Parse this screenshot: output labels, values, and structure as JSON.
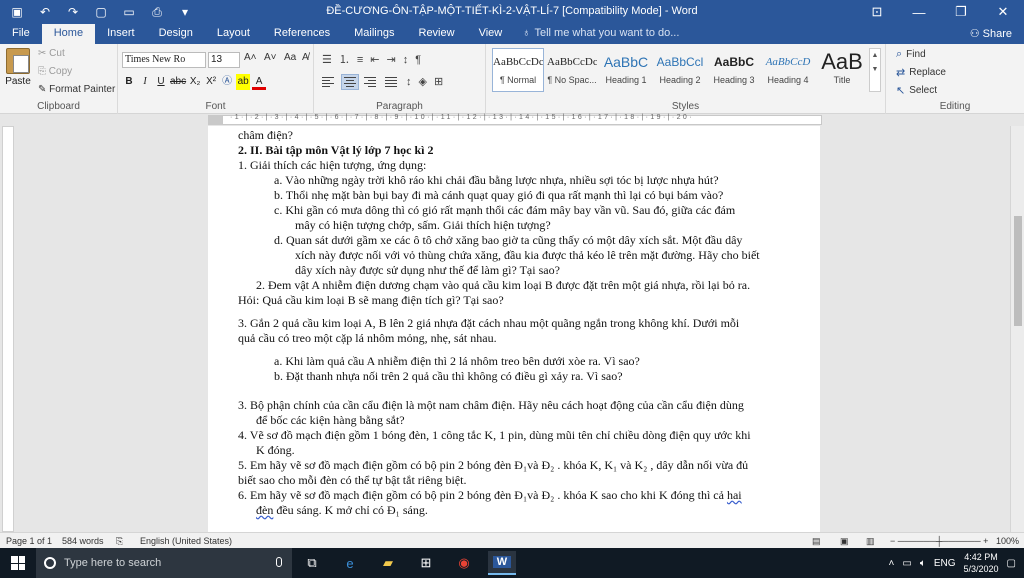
{
  "window": {
    "title": "ĐỀ-CƯƠNG-ÔN-TẬP-MỘT-TIẾT-KÌ-2-VẬT-LÍ-7 [Compatibility Mode] - Word",
    "controls": {
      "minimize": "—",
      "restore": "❐",
      "close": "✕"
    }
  },
  "ribbon_tabs": [
    "File",
    "Home",
    "Insert",
    "Design",
    "Layout",
    "References",
    "Mailings",
    "Review",
    "View"
  ],
  "tell_me": "Tell me what you want to do...",
  "share": "Share",
  "clipboard": {
    "paste": "Paste",
    "cut": "Cut",
    "copy": "Copy",
    "format_painter": "Format Painter",
    "label": "Clipboard"
  },
  "font": {
    "name": "Times New Ro",
    "size": "13",
    "label": "Font",
    "buttons": [
      "B",
      "I",
      "U",
      "abc",
      "X₂",
      "X²"
    ],
    "grow": "A˄",
    "shrink": "A˅",
    "case": "Aa"
  },
  "paragraph": {
    "label": "Paragraph",
    "show_marks": "¶",
    "sort": "↕"
  },
  "styles": {
    "label": "Styles",
    "items": [
      {
        "sample": "AaBbCcDc",
        "name": "¶ Normal"
      },
      {
        "sample": "AaBbCcDc",
        "name": "¶ No Spac..."
      },
      {
        "sample": "AaBbC",
        "name": "Heading 1"
      },
      {
        "sample": "AaBbCcl",
        "name": "Heading 2"
      },
      {
        "sample": "AaBbC",
        "name": "Heading 3"
      },
      {
        "sample": "AaBbCcD",
        "name": "Heading 4"
      },
      {
        "sample": "AaB",
        "name": "Title"
      }
    ]
  },
  "editing": {
    "find": "Find",
    "replace": "Replace",
    "select": "Select",
    "label": "Editing"
  },
  "ruler_marks": "·1·|·2·|·3·|·4·|·5·|·6·|·7·|·8·|·9·|·10·|·11·|·12·|·13·|·14·|·15·|·16·|·17·|·18·|·19·|·20·",
  "document": {
    "line0": "châm điện?",
    "section": "2.   II. Bài tập môn Vật lý lớp 7 học kì 2",
    "q1": "1.   Giải thích các hiện tượng, ứng dụng:",
    "q1a": "a.   Vào những ngày trời khô ráo khi chải đầu bằng lược nhựa, nhiều sợi tóc bị lược nhựa hút?",
    "q1b": "b.   Thổi nhẹ mặt bàn bụi bay đi mà cánh quạt quay gió đi qua rất mạnh thì lại có bụi bám vào?",
    "q1c_1": "c.   Khi gần có mưa dông thì có gió rất mạnh thổi các đám mây bay vần vũ. Sau đó, giữa các đám",
    "q1c_2": "mây có hiện tượng chớp, sấm. Giải thích hiện tượng?",
    "q1d_1": "d.   Quan sát dưới gầm xe các ô tô chở xăng bao giờ ta cũng thấy có một dây xích sắt. Một đầu dây",
    "q1d_2": "xích này được nối với vỏ thùng chứa xăng, đầu kia được thả kéo lê trên mặt đường. Hãy cho biết",
    "q1d_3": "dây xích này được sử dụng như thế để làm gì? Tại sao?",
    "q2_1": "2.   Đem vật A nhiễm điện dương chạm vào quả cầu kim loại B được đặt trên một giá nhựa, rồi lại bỏ ra.",
    "q2_2": "Hỏi: Quả cầu kim loại B sẽ mang điện tích gì? Tại sao?",
    "q3_1": "3. Gắn 2 quả cầu kim loại A, B lên 2 giá nhựa đặt cách nhau một quãng ngắn trong không khí. Dưới mỗi",
    "q3_2": "quả cầu có treo một cặp lá nhôm mỏng, nhẹ, sát nhau.",
    "q3a": "a.   Khi làm quả cầu A nhiễm điện thì 2 lá nhôm treo bên dưới xòe ra. Vì sao?",
    "q3b": "b.   Đặt thanh nhựa nối trên 2 quả cầu thì không có điều gì xảy ra. Vì sao?",
    "q3n_1": "3.   Bộ phận chính của cần cẩu điện là một nam châm điện. Hãy nêu cách hoạt động của cần cẩu điện dùng",
    "q3n_2": "để bốc các kiện hàng bằng sắt?",
    "q4_1": "4.   Vẽ sơ đồ mạch điện gồm 1 bóng đèn, 1 công tắc K, 1 pin, dùng mũi tên chỉ chiều dòng điện quy ước khi",
    "q4_2": "K đóng.",
    "q5_1": "5.    Em hãy vẽ sơ đồ mạch điện gồm có bộ pin 2 bóng đèn Đ₁và Đ₂ . khóa K, K₁ và K₂ , dây dẫn nối vừa đủ",
    "q5_2": "biết sao cho mỗi đèn có thể tự bật tắt riêng biệt.",
    "q6_1a": "6.   Em hãy vẽ sơ đồ mạch điện gồm có bộ pin 2 bóng đèn Đ₁và Đ₂ . khóa K sao cho khi K đóng thì cả ",
    "q6_1b": "hai",
    "q6_2a": "đèn",
    "q6_2b": " đều sáng. K mở chỉ có Đ₁ sáng."
  },
  "status": {
    "page": "Page 1 of 1",
    "words": "584 words",
    "language": "English (United States)",
    "zoom": "100%"
  },
  "taskbar": {
    "search_placeholder": "Type here to search",
    "time": "4:42 PM",
    "date": "5/3/2020",
    "lang": "ENG"
  },
  "colors": {
    "word_blue": "#2b579a",
    "taskbar": "#101a24"
  }
}
